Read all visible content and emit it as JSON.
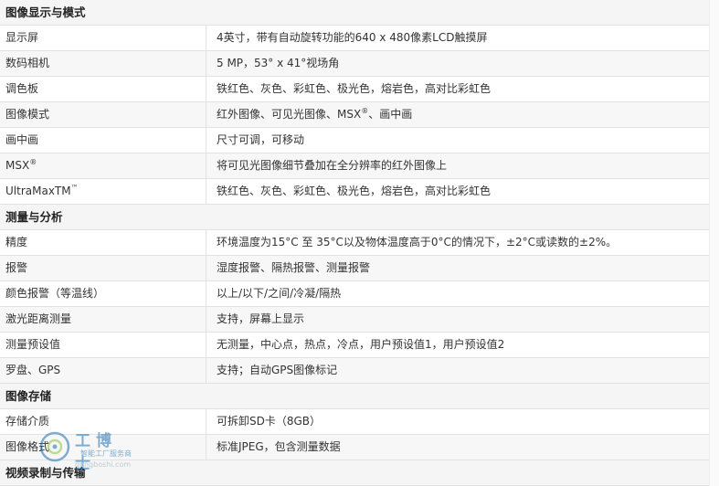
{
  "sections": [
    {
      "title": "图像显示与模式",
      "rows": [
        {
          "label": "显示屏",
          "value": "4英寸，带有自动旋转功能的640 x 480像素LCD触摸屏"
        },
        {
          "label": "数码相机",
          "value": "5 MP，53° x 41°视场角"
        },
        {
          "label": "调色板",
          "value": "铁红色、灰色、彩虹色、极光色，熔岩色，高对比彩虹色"
        },
        {
          "label": "图像模式",
          "value_pre": "红外图像、可见光图像、MSX",
          "value_sup": "®",
          "value_post": "、画中画"
        },
        {
          "label": "画中画",
          "value": "尺寸可调，可移动"
        },
        {
          "label_pre": "MSX",
          "label_sup": "®",
          "value": "将可见光图像细节叠加在全分辨率的红外图像上"
        },
        {
          "label_pre": "UltraMaxTM",
          "label_sup": "™",
          "value": "铁红色、灰色、彩虹色、极光色，熔岩色，高对比彩虹色"
        }
      ]
    },
    {
      "title": "测量与分析",
      "rows": [
        {
          "label": "精度",
          "value": "环境温度为15°C 至 35°C以及物体温度高于0°C的情况下，±2°C或读数的±2%。"
        },
        {
          "label": "报警",
          "value": "湿度报警、隔热报警、测量报警"
        },
        {
          "label": "颜色报警（等温线）",
          "value": "以上/以下/之间/冷凝/隔热"
        },
        {
          "label": "激光距离测量",
          "value": "支持，屏幕上显示"
        },
        {
          "label": "测量预设值",
          "value": "无测量，中心点，热点，冷点，用户预设值1，用户预设值2"
        },
        {
          "label": "罗盘、GPS",
          "value": "支持；自动GPS图像标记"
        }
      ]
    },
    {
      "title": "图像存储",
      "rows": [
        {
          "label": "存储介质",
          "value": "可拆卸SD卡（8GB）"
        },
        {
          "label": "图像格式",
          "value": "标准JPEG，包含测量数据"
        }
      ]
    },
    {
      "title": "视频录制与传输",
      "rows": []
    }
  ],
  "watermark": {
    "title": "工博士",
    "subtitle": "智能工厂服务商",
    "url": "gongboshi.com"
  }
}
